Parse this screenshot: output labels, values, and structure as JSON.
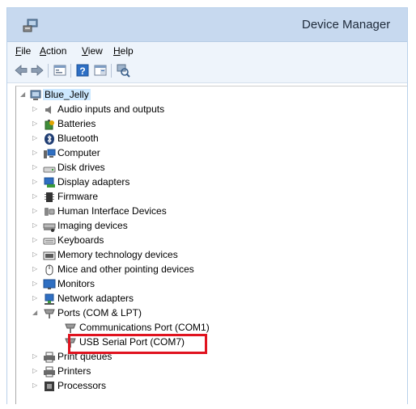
{
  "window": {
    "title": "Device Manager"
  },
  "menu": {
    "file": {
      "mnemonic": "F",
      "rest": "ile"
    },
    "action": {
      "mnemonic": "A",
      "rest": "ction"
    },
    "view": {
      "mnemonic": "V",
      "rest": "iew"
    },
    "help": {
      "mnemonic": "H",
      "rest": "elp"
    }
  },
  "toolbar": {
    "buttons": [
      "back-icon",
      "forward-icon",
      "properties-icon",
      "help-icon",
      "console-icon",
      "scan-hardware-icon"
    ]
  },
  "tree": {
    "root": "Blue_Jelly",
    "categories": [
      "Audio inputs and outputs",
      "Batteries",
      "Bluetooth",
      "Computer",
      "Disk drives",
      "Display adapters",
      "Firmware",
      "Human Interface Devices",
      "Imaging devices",
      "Keyboards",
      "Memory technology devices",
      "Mice and other pointing devices",
      "Monitors",
      "Network adapters",
      "Ports (COM & LPT)",
      "Print queues",
      "Printers",
      "Processors"
    ],
    "ports_children": [
      "Communications Port (COM1)",
      "USB Serial Port (COM7)"
    ]
  },
  "colors": {
    "titlebar": "#c7d9ef",
    "highlight_border": "#e0131f",
    "root_selection": "#cce8ff"
  }
}
